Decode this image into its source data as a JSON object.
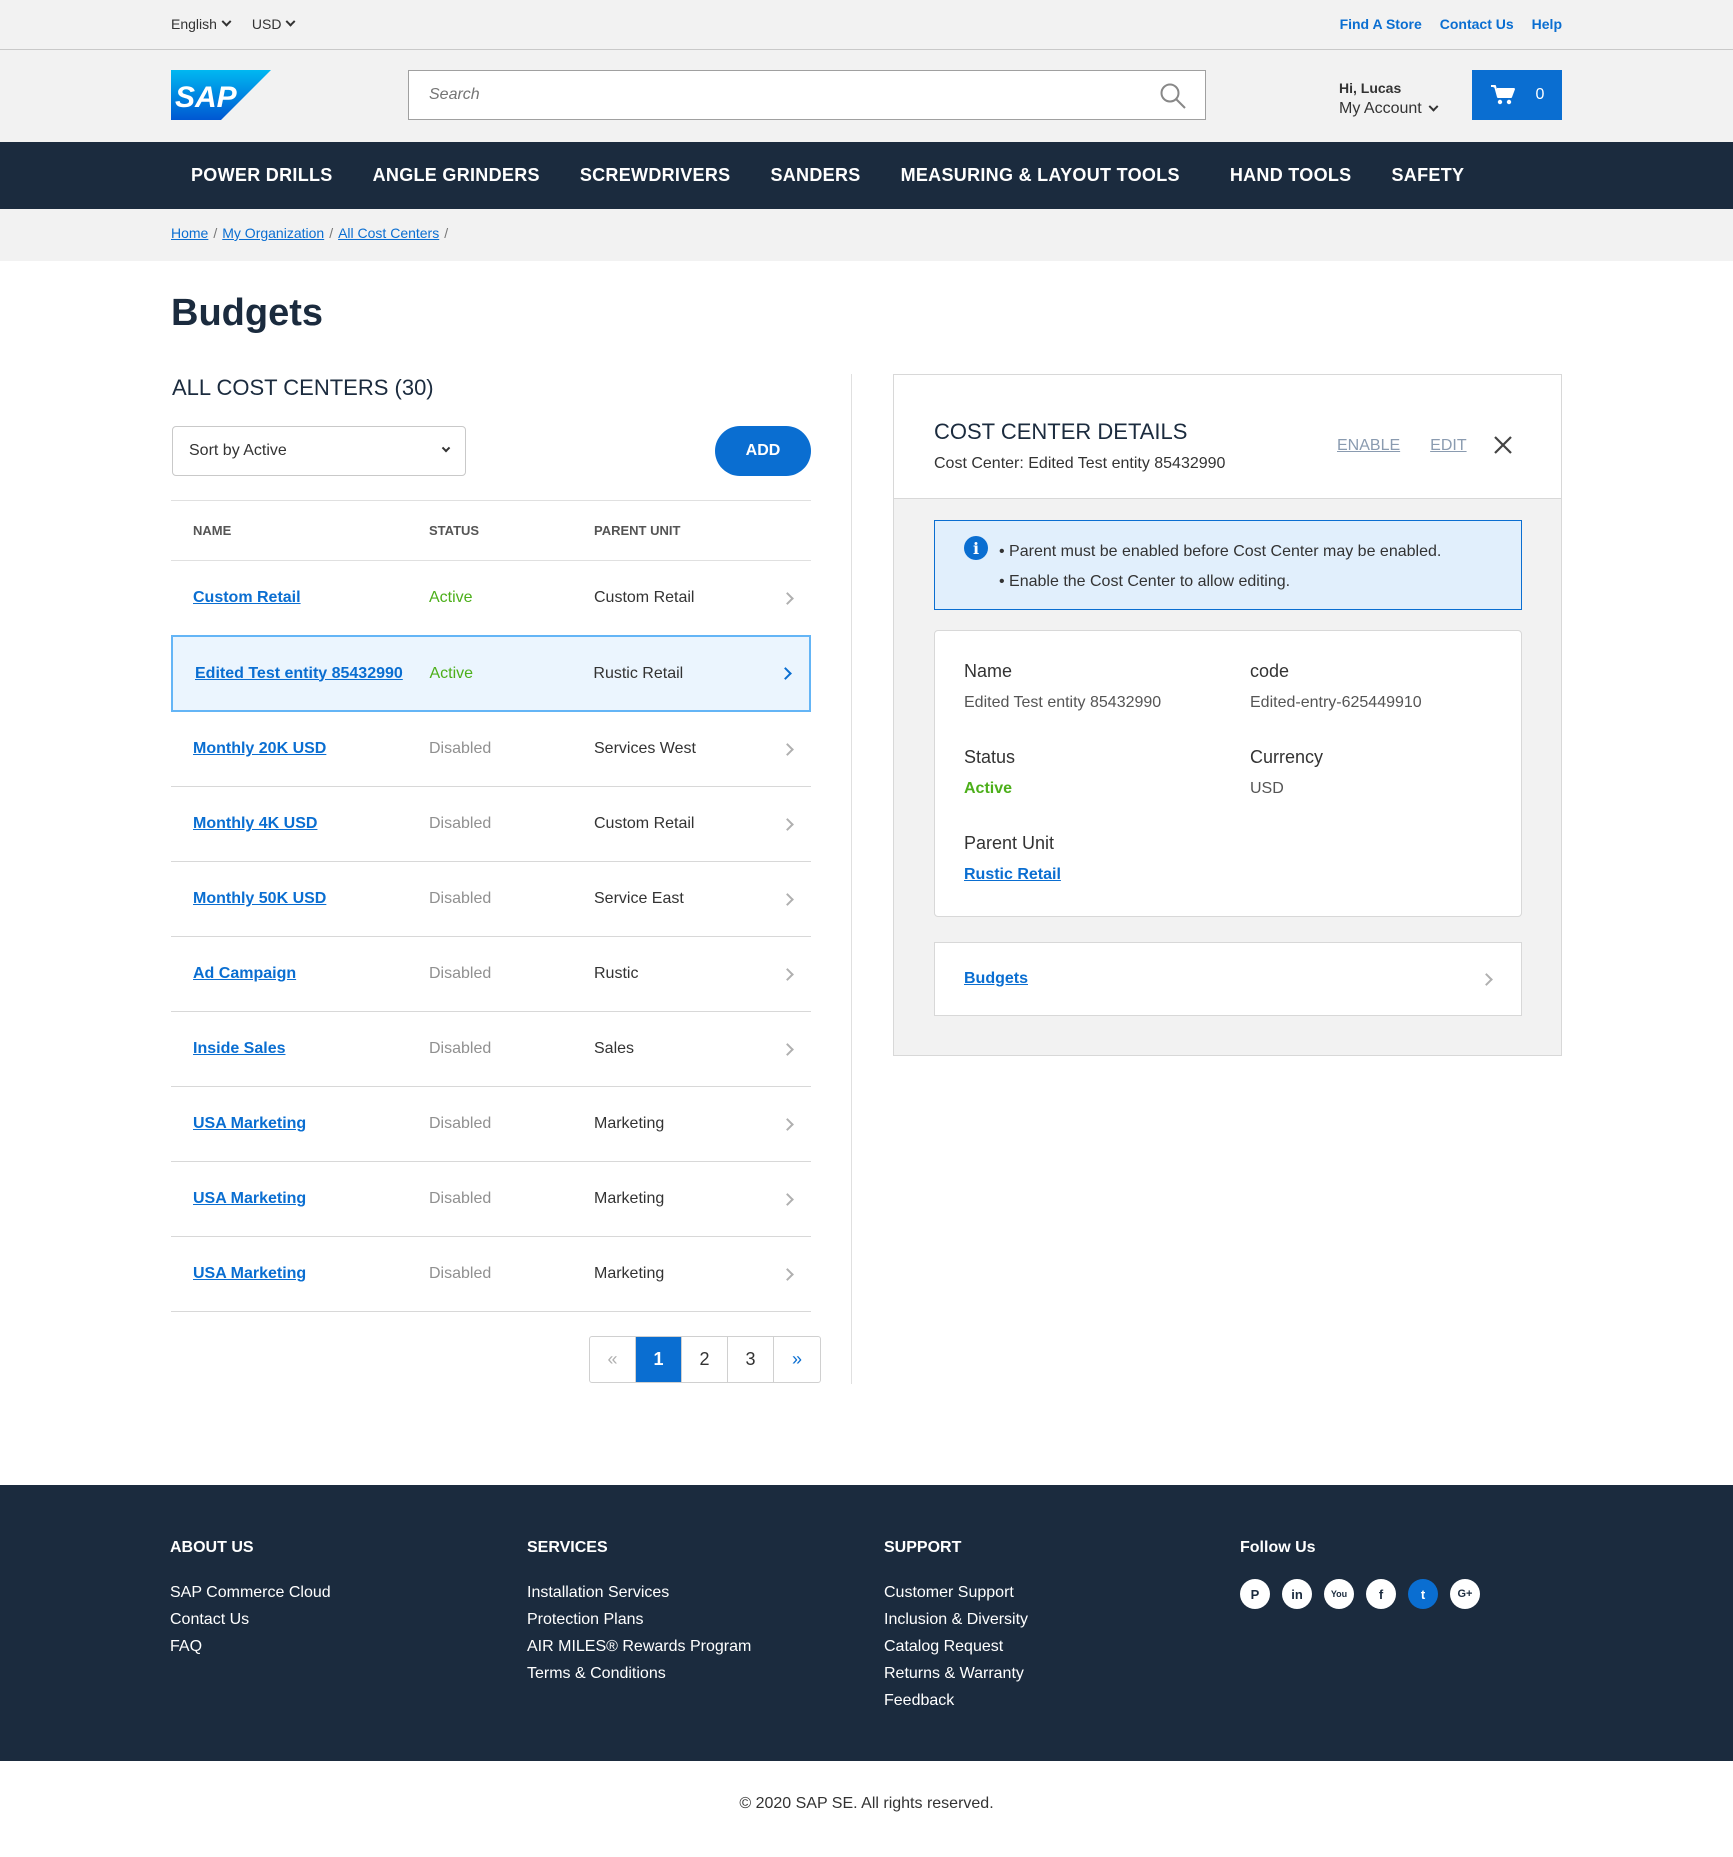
{
  "topbar": {
    "language": "English",
    "currency": "USD",
    "links": [
      "Find A Store",
      "Contact Us",
      "Help"
    ]
  },
  "header": {
    "logo": "SAP",
    "search_placeholder": "Search",
    "greeting": "Hi, Lucas",
    "account": "My Account",
    "cart_count": "0"
  },
  "nav": [
    "POWER DRILLS",
    "ANGLE GRINDERS",
    "SCREWDRIVERS",
    "SANDERS",
    "MEASURING & LAYOUT TOOLS",
    "HAND TOOLS",
    "SAFETY"
  ],
  "breadcrumb": [
    "Home",
    "My Organization",
    "All Cost Centers"
  ],
  "page_title": "Budgets",
  "list": {
    "title": "ALL COST CENTERS (30)",
    "sort_label": "Sort by Active",
    "add_label": "ADD",
    "columns": [
      "NAME",
      "STATUS",
      "PARENT UNIT"
    ],
    "rows": [
      {
        "name": "Custom Retail",
        "status": "Active",
        "parent": "Custom Retail"
      },
      {
        "name": "Edited Test entity 85432990",
        "status": "Active",
        "parent": "Rustic Retail"
      },
      {
        "name": "Monthly 20K USD",
        "status": "Disabled",
        "parent": "Services West"
      },
      {
        "name": "Monthly 4K USD",
        "status": "Disabled",
        "parent": "Custom Retail"
      },
      {
        "name": "Monthly 50K USD",
        "status": "Disabled",
        "parent": "Service East"
      },
      {
        "name": "Ad Campaign",
        "status": "Disabled",
        "parent": "Rustic"
      },
      {
        "name": "Inside Sales",
        "status": "Disabled",
        "parent": "Sales"
      },
      {
        "name": "USA Marketing",
        "status": "Disabled",
        "parent": "Marketing"
      },
      {
        "name": "USA Marketing",
        "status": "Disabled",
        "parent": "Marketing"
      },
      {
        "name": "USA Marketing",
        "status": "Disabled",
        "parent": "Marketing"
      }
    ],
    "selected_index": 1,
    "pagination": {
      "prev": "«",
      "pages": [
        "1",
        "2",
        "3"
      ],
      "current": "1",
      "next": "»"
    }
  },
  "details": {
    "title": "COST CENTER DETAILS",
    "subtitle": "Cost Center: Edited Test entity 85432990",
    "enable_label": "ENABLE",
    "edit_label": "EDIT",
    "info": [
      "Parent must be enabled before Cost Center may be enabled.",
      "Enable the Cost Center to allow editing."
    ],
    "fields": {
      "name_label": "Name",
      "name_value": "Edited Test entity 85432990",
      "code_label": "code",
      "code_value": "Edited-entry-625449910",
      "status_label": "Status",
      "status_value": "Active",
      "currency_label": "Currency",
      "currency_value": "USD",
      "parent_label": "Parent Unit",
      "parent_value": "Rustic Retail"
    },
    "budgets_link": "Budgets"
  },
  "footer": {
    "about": {
      "title": "ABOUT US",
      "items": [
        "SAP Commerce Cloud",
        "Contact Us",
        "FAQ"
      ]
    },
    "services": {
      "title": "SERVICES",
      "items": [
        "Installation Services",
        "Protection Plans",
        "AIR MILES® Rewards Program",
        "Terms & Conditions"
      ]
    },
    "support": {
      "title": "SUPPORT",
      "items": [
        "Customer Support",
        "Inclusion & Diversity",
        "Catalog Request",
        "Returns & Warranty",
        "Feedback"
      ]
    },
    "follow": {
      "title": "Follow Us",
      "icons": [
        "pinterest-icon",
        "linkedin-icon",
        "youtube-icon",
        "facebook-icon",
        "twitter-icon",
        "google-plus-icon"
      ]
    },
    "copyright": "© 2020 SAP SE. All rights reserved."
  },
  "colors": {
    "accent": "#0a6ed1",
    "nav_bg": "#1b2b3e",
    "active": "#4caf1a",
    "disabled": "#909090"
  }
}
